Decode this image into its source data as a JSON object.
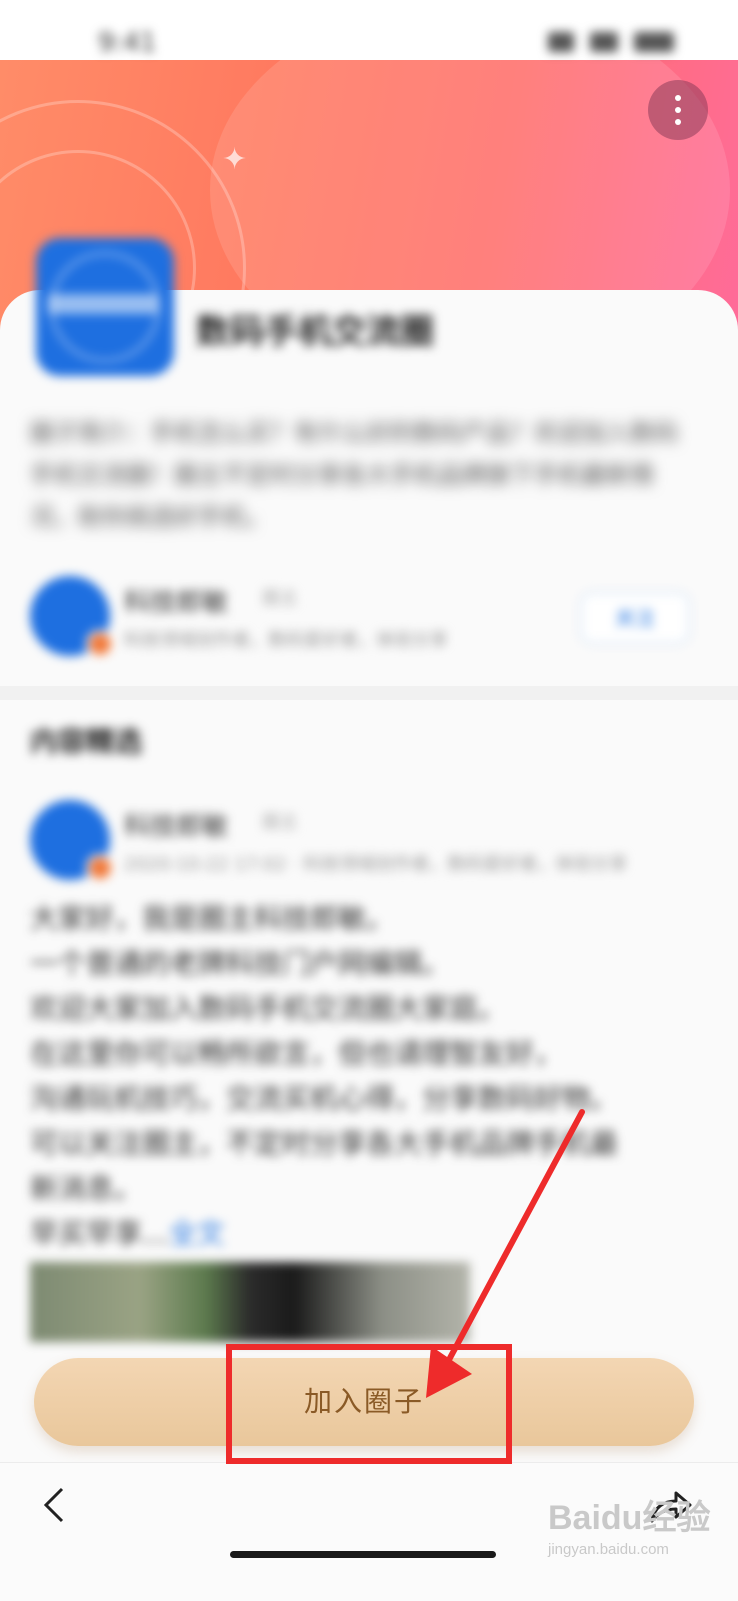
{
  "status_bar": {
    "time": "9:41"
  },
  "circle": {
    "name": "数码手机交流圈",
    "description": "圈子简介：手机怎么买？有什么好的数码产品？欢迎加入数码手机交流圈！圈主不定时分享各大手机品牌旗下手机最新情况，助你挑选好手机。"
  },
  "owner": {
    "name": "科技郎敏",
    "tag": "圈主",
    "subtitle": "科技领域创作者，数码爱好者，体验分享",
    "follow_label": "关注"
  },
  "section": {
    "title": "内容精选"
  },
  "post": {
    "author_name": "科技郎敏",
    "author_tag": "圈主",
    "meta": "2020-10-22 17:02 · 科技领域创作者，数码爱好者，体验分享",
    "lines": [
      "大家好，我是圈主科技郎敏。",
      "一个普通的老牌科技门户网编辑。",
      "欢迎大家加入数码手机交流圈大家庭。",
      "在这里你可以畅所欲言，但也请理智友好，",
      "沟通玩机技巧，交流买机心得，分享数码好物。",
      "可以关注圈主，不定时分享各大手机品牌手机最",
      "新消息。",
      "早买早享..."
    ],
    "more_link": "全文"
  },
  "join_button": {
    "label": "加入圈子"
  },
  "watermark": {
    "logo": "Baidu经验",
    "url": "jingyan.baidu.com"
  },
  "icons": {
    "more": "more-vertical-icon",
    "back": "chevron-left-icon",
    "share": "share-arrow-icon"
  },
  "colors": {
    "header_gradient_start": "#ff8c68",
    "header_gradient_end": "#ff6b9a",
    "brand_blue": "#1e6fe0",
    "join_button": "#e9c79b",
    "join_text": "#8a5a26",
    "annotation_red": "#ee2b2b"
  }
}
